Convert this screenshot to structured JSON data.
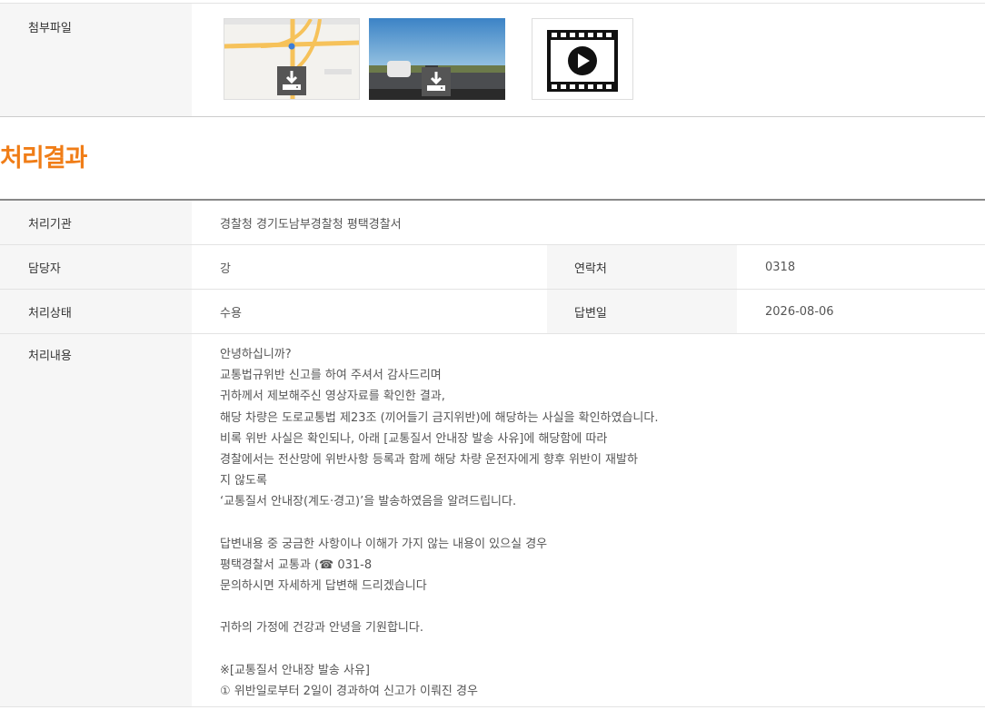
{
  "attachments": {
    "label": "첨부파일",
    "files": [
      {
        "type": "map-image",
        "icon": "download-icon"
      },
      {
        "type": "photo-image",
        "icon": "download-icon"
      },
      {
        "type": "video",
        "icon": "play-icon"
      }
    ]
  },
  "section_title": "처리결과",
  "result": {
    "agency_label": "처리기관",
    "agency_value": "경찰청 경기도남부경찰청 평택경찰서",
    "manager_label": "담당자",
    "manager_value": "강",
    "contact_label": "연락처",
    "contact_value": "0318",
    "status_label": "처리상태",
    "status_value": "수용",
    "reply_date_label": "답변일",
    "reply_date_value": "2026-08-06",
    "content_label": "처리내용",
    "content_lines": [
      "안녕하십니까?",
      "교통법규위반 신고를 하여 주셔서 감사드리며",
      "귀하께서 제보해주신 영상자료를 확인한 결과,",
      "해당 차량은 도로교통법 제23조 (끼어들기 금지위반)에 해당하는 사실을 확인하였습니다.",
      "비록 위반 사실은 확인되나, 아래 [교통질서 안내장 발송 사유]에 해당함에 따라",
      "경찰에서는 전산망에 위반사항 등록과 함께 해당 차량 운전자에게 향후 위반이 재발하",
      "지 않도록",
      "‘교통질서 안내장(계도·경고)’을 발송하였음을 알려드립니다.",
      "",
      "답변내용 중 궁금한 사항이나 이해가 가지 않는 내용이 있으실 경우",
      "평택경찰서 교통과 (☎ 031-8",
      "문의하시면 자세하게 답변해 드리겠습니다",
      "",
      "귀하의 가정에 건강과 안녕을 기원합니다.",
      "",
      "※[교통질서 안내장 발송 사유]",
      "① 위반일로부터 2일이 경과하여 신고가 이뤄진 경우"
    ]
  },
  "colors": {
    "accent": "#f07d17",
    "header_bg": "#f6f6f6"
  }
}
